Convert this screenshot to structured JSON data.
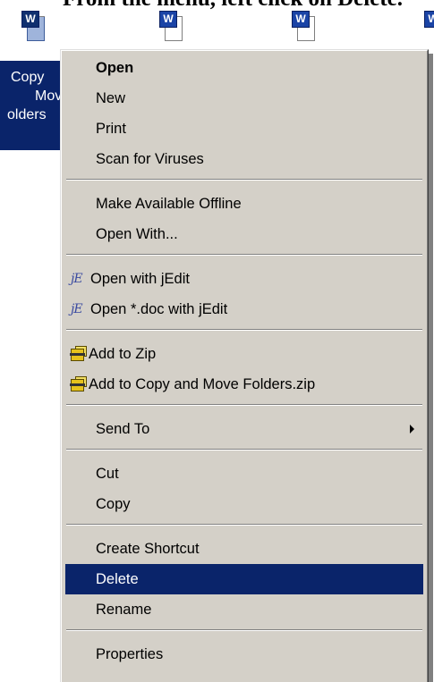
{
  "caption": "From the menu, left click on Delete.",
  "desktop": {
    "icon_badge": "W",
    "selected_label_lines": [
      "Copy",
      "Mov",
      "olders"
    ]
  },
  "menu": {
    "open": "Open",
    "new": "New",
    "print": "Print",
    "scan": "Scan for Viruses",
    "offline": "Make Available Offline",
    "open_with": "Open With...",
    "jedit": "Open with jEdit",
    "jedit_doc": "Open *.doc with jEdit",
    "add_zip": "Add to Zip",
    "add_named_zip": "Add to Copy and Move Folders.zip",
    "send_to": "Send To",
    "cut": "Cut",
    "copy": "Copy",
    "shortcut": "Create Shortcut",
    "delete": "Delete",
    "rename": "Rename",
    "properties": "Properties"
  },
  "icons": {
    "jedit": "jedit-icon",
    "zip": "zip-icon",
    "submenu": "submenu-arrow-icon"
  },
  "colors": {
    "menu_bg": "#d4d0c8",
    "highlight": "#0a246a",
    "highlight_text": "#ffffff"
  }
}
